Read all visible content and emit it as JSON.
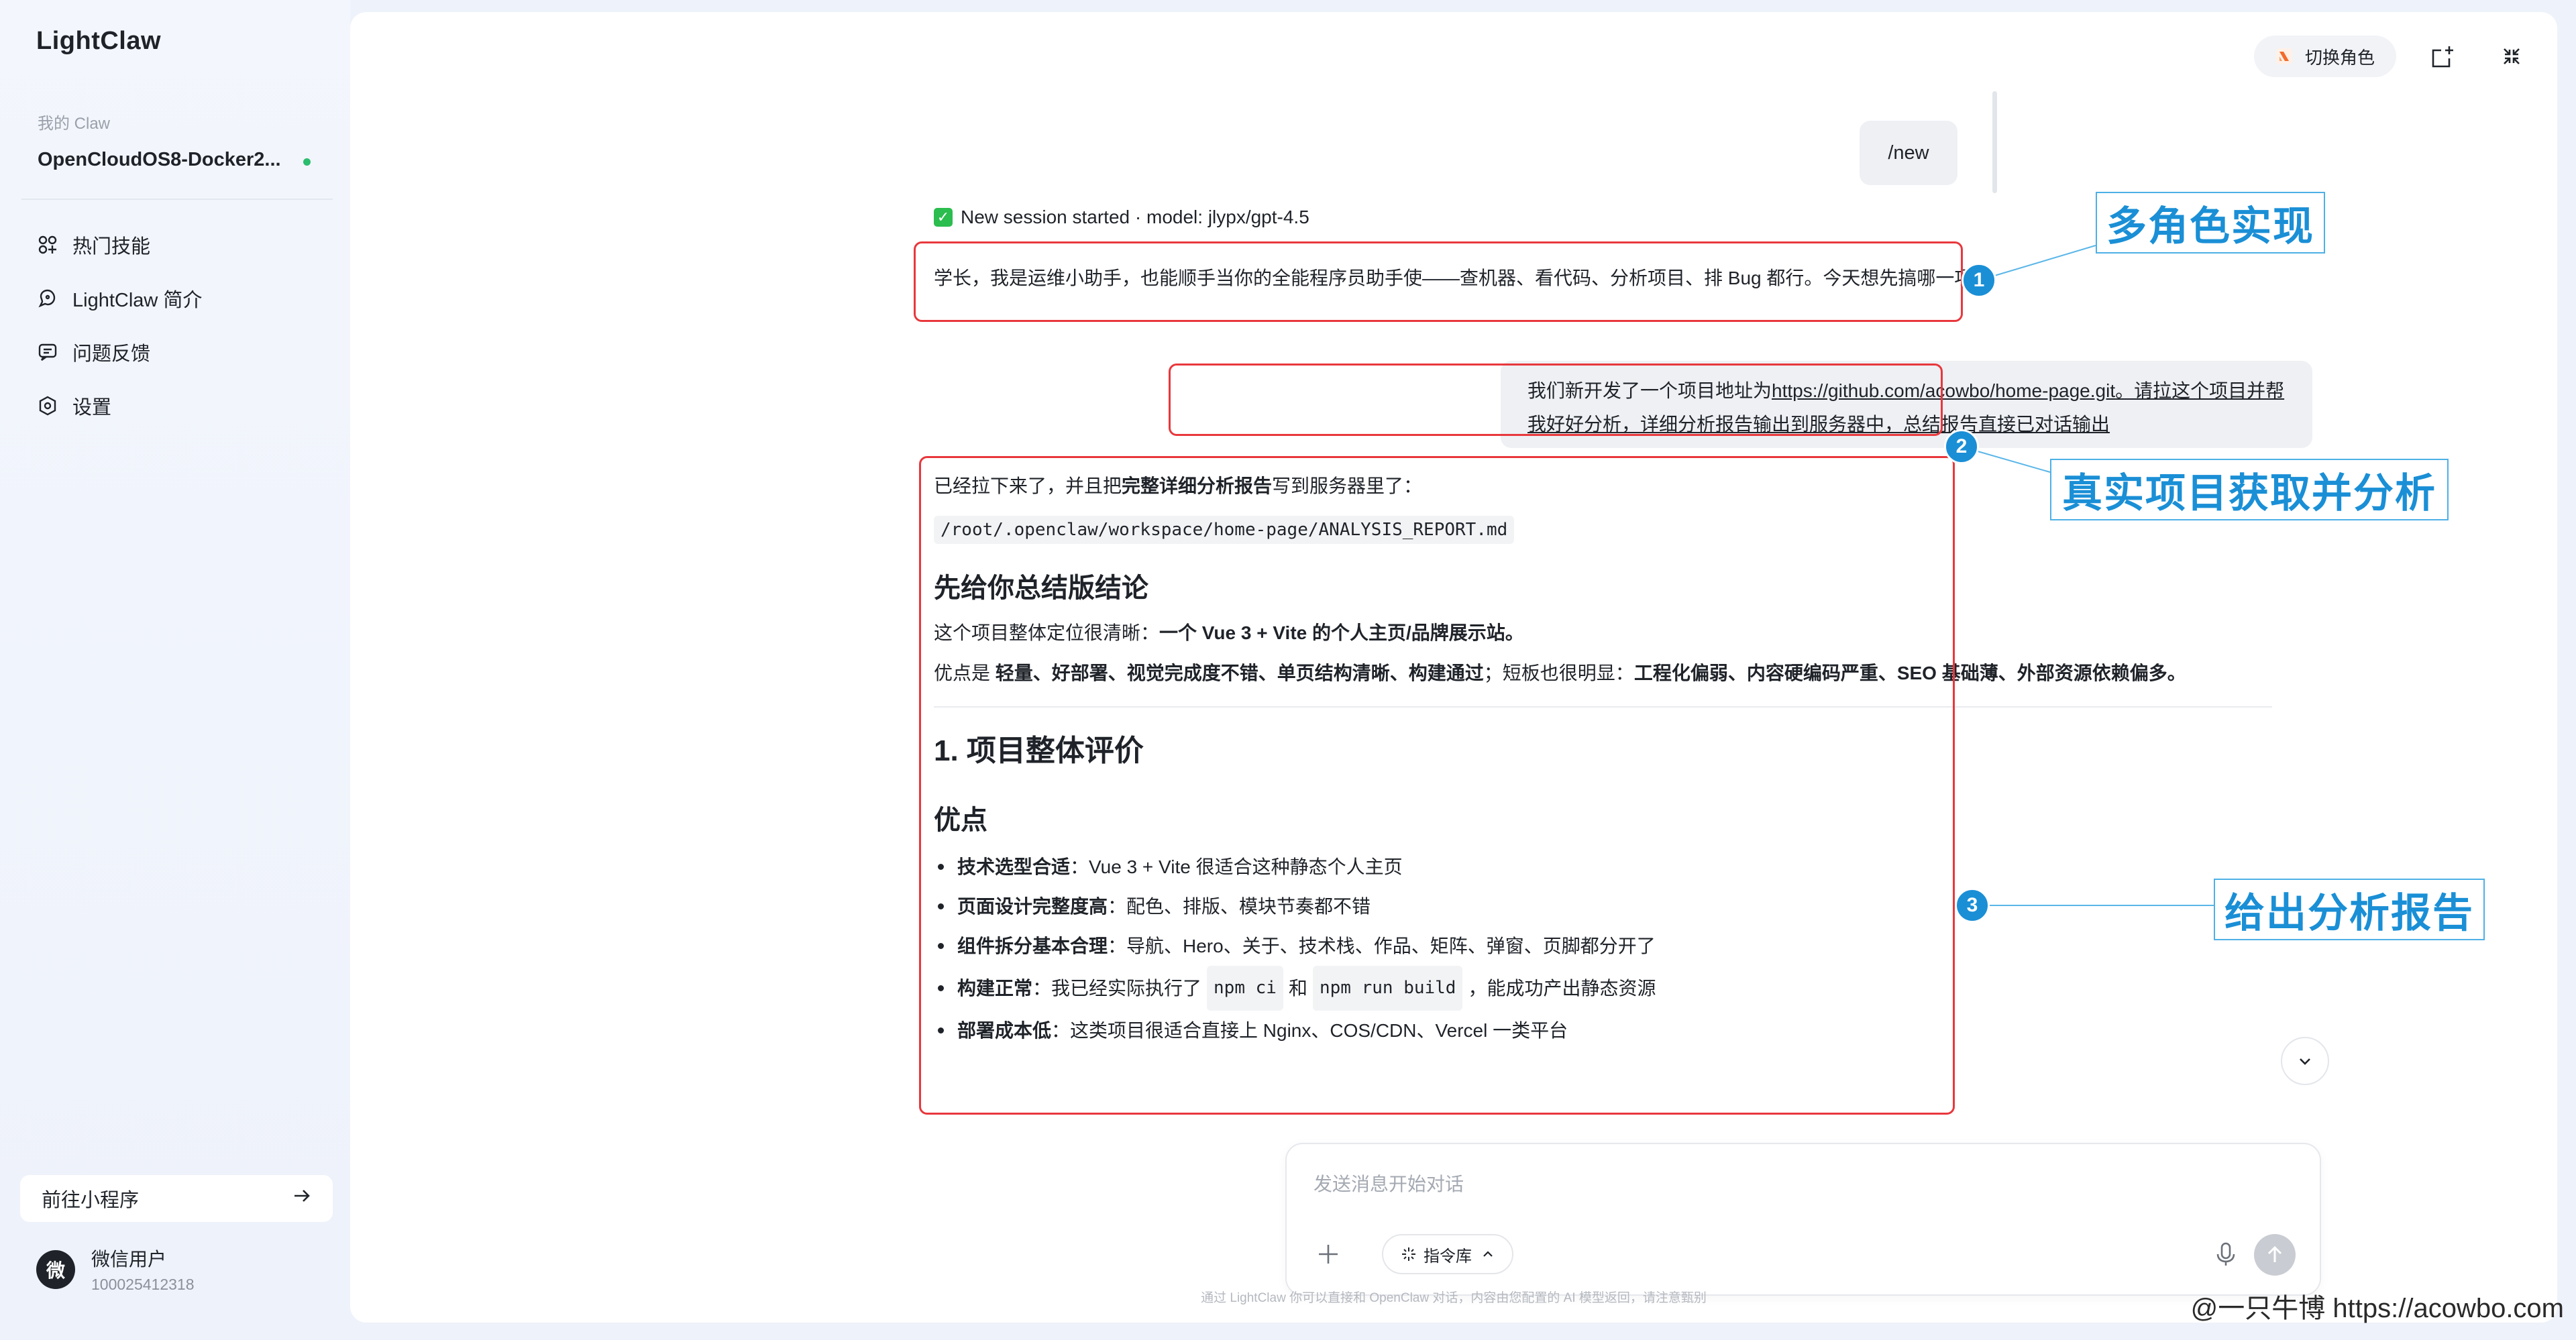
{
  "sidebar": {
    "brand": "LightClaw",
    "claw_label": "我的 Claw",
    "claw_name": "OpenCloudOS8-Docker2...",
    "nav": [
      {
        "label": "热门技能",
        "icon": "skills-icon"
      },
      {
        "label": "LightClaw 简介",
        "icon": "intro-icon"
      },
      {
        "label": "问题反馈",
        "icon": "feedback-icon"
      },
      {
        "label": "设置",
        "icon": "settings-icon"
      }
    ],
    "miniprogram_label": "前往小程序",
    "user": {
      "avatar_char": "微",
      "name": "微信用户",
      "id": "100025412318"
    }
  },
  "header": {
    "switch_role_label": "切换角色"
  },
  "chat": {
    "new_command": "/new",
    "session_text": "New session started · model: jlypx/gpt-4.5",
    "assistant_intro": "学长，我是运维小助手，也能顺手当你的全能程序员助手使——查机器、看代码、分析项目、排 Bug 都行。今天想先搞哪一项?",
    "user_prefix": "我们新开发了一个项目地址为",
    "user_link": "https://github.com/acowbo/home-page.git",
    "user_suffix": "。请拉这个项目并帮我好好分析，详细分析报告输出到服务器中，总结报告直接已对话输出",
    "report": {
      "intro_a": "已经拉下来了，并且把",
      "intro_bold": "完整详细分析报告",
      "intro_b": "写到服务器里了：",
      "path": "/root/.openclaw/workspace/home-page/ANALYSIS_REPORT.md",
      "summary_heading": "先给你总结版结论",
      "position_a": "这个项目整体定位很清晰：",
      "position_bold": "一个 Vue 3 + Vite 的个人主页/品牌展示站。",
      "pros_a": "优点是 ",
      "pros_bold": "轻量、好部署、视觉完成度不错、单页结构清晰、构建通过",
      "pros_b": "；短板也很明显：",
      "cons_bold": "工程化偏弱、内容硬编码严重、SEO 基础薄、外部资源依赖偏多。",
      "section1": "1. 项目整体评价",
      "pros_heading": "优点",
      "bullets": [
        {
          "title": "技术选型合适",
          "text": "：Vue 3 + Vite 很适合这种静态个人主页"
        },
        {
          "title": "页面设计完整度高",
          "text": "：配色、排版、模块节奏都不错"
        },
        {
          "title": "组件拆分基本合理",
          "text": "：导航、Hero、关于、技术栈、作品、矩阵、弹窗、页脚都分开了"
        },
        {
          "title": "构建正常",
          "text": "：我已经实际执行了",
          "code1": "npm ci",
          "mid": "和",
          "code2": "npm run build",
          "tail": "，能成功产出静态资源"
        },
        {
          "title": "部署成本低",
          "text": "：这类项目很适合直接上 Nginx、COS/CDN、Vercel 一类平台"
        }
      ]
    }
  },
  "input": {
    "placeholder": "发送消息开始对话",
    "command_label": "指令库",
    "footnote": "通过 LightClaw 你可以直接和 OpenClaw 对话，内容由您配置的 AI 模型返回，请注意甄别"
  },
  "annotations": [
    {
      "number": "1",
      "label": "多角色实现"
    },
    {
      "number": "2",
      "label": "真实项目获取并分析"
    },
    {
      "number": "3",
      "label": "给出分析报告"
    }
  ],
  "watermark": "@一只牛博 https://acowbo.com",
  "colors": {
    "accent_annotation": "#1a8fd6",
    "highlight_box": "#e8383d",
    "online": "#2bbd6e"
  }
}
